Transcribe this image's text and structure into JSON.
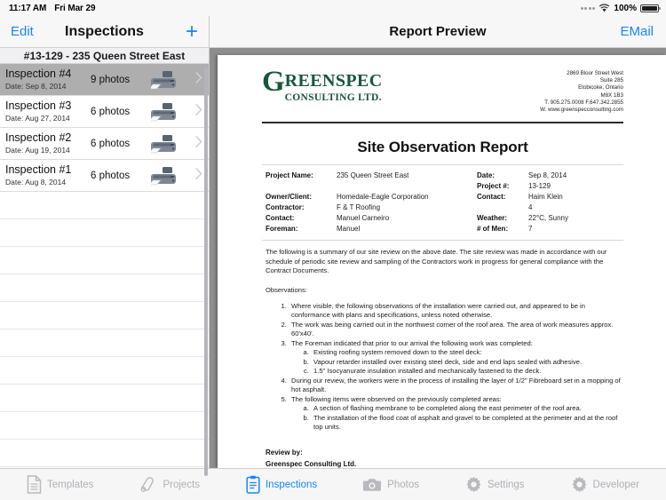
{
  "status_bar": {
    "time": "11:17 AM",
    "date": "Fri Mar 29",
    "battery_pct": "100%",
    "wifi_icon": "wifi-icon",
    "battery_icon": "battery-icon"
  },
  "left_nav": {
    "edit_label": "Edit",
    "title": "Inspections",
    "add_label": "+",
    "add_icon": "plus-icon"
  },
  "list": {
    "section_header": "#13-129 - 235 Queen Street East",
    "rows": [
      {
        "title": "Inspection #4",
        "date": "Date: Sep 8, 2014",
        "photos": "9 photos",
        "selected": true
      },
      {
        "title": "Inspection #3",
        "date": "Date: Aug 27, 2014",
        "photos": "6 photos",
        "selected": false
      },
      {
        "title": "Inspection #2",
        "date": "Date: Aug 19, 2014",
        "photos": "6 photos",
        "selected": false
      },
      {
        "title": "Inspection #1",
        "date": "Date: Aug 8, 2014",
        "photos": "6 photos",
        "selected": false
      }
    ],
    "empty_row_count": 11,
    "row_icon": "printer-icon",
    "disclosure_icon": "chevron-right-icon"
  },
  "doc_nav": {
    "title": "Report Preview",
    "email_label": "EMail"
  },
  "letterhead": {
    "logo_drop_cap": "G",
    "logo_main": "REENSPEC",
    "logo_sub": "CONSULTING LTD.",
    "logo_color": "#16573a",
    "address_lines": [
      "2869 Bloor Street West",
      "Suite 285",
      "Etobicoke, Ontario",
      "M8X 1B3",
      "T. 905.275.0008   F.647.342.2855",
      "W. www.greenspecconsulting.com"
    ]
  },
  "report": {
    "title": "Site Observation Report",
    "info_left": [
      {
        "label": "Project Name:",
        "value": "235 Queen Street East"
      },
      {
        "label": "",
        "value": ""
      },
      {
        "label": "Owner/Client:",
        "value": "Homedale-Eagle Corporation"
      },
      {
        "label": "Contractor:",
        "value": "F & T Roofing"
      },
      {
        "label": "Contact:",
        "value": "Manuel Carneiro"
      },
      {
        "label": "Foreman:",
        "value": "Manuel"
      }
    ],
    "info_right": [
      {
        "label": "Date:",
        "value": "Sep 8, 2014"
      },
      {
        "label": "Project #:",
        "value": "13-129"
      },
      {
        "label": "Contact:",
        "value": "Haim Klein"
      },
      {
        "label": "",
        "value": "4"
      },
      {
        "label": "Weather:",
        "value": "22°C, Sunny"
      },
      {
        "label": "# of Men:",
        "value": "7"
      }
    ],
    "intro_paragraph": "The following is a summary of our site review on the above date. The site review was made in accordance with our schedule of periodic site review and sampling of the Contractors work in progress for general compliance with the Contract Documents.",
    "observations_label": "Observations:",
    "observations": [
      {
        "text": "Where visible, the following observations of the installation were carried out, and appeared to be in conformance with plans and specifications, unless noted otherwise.",
        "sub": []
      },
      {
        "text": "The work was being carried out in the northwest corner of the roof area.  The area of work measures approx. 60'x40'.",
        "sub": []
      },
      {
        "text": "The Foreman indicated that prior to our arrival the following work was completed:",
        "sub": [
          "Existing roofing system removed down to the steel deck:",
          "Vapour retarder installed over existing steel deck, side and end laps sealed with adhesive.",
          "1.5\" Isocyanurate insulation installed and mechanically fastened to the deck."
        ]
      },
      {
        "text": "During our review, the workers were in the process of installing the layer of 1/2\" Fibreboard set in a mopping of hot asphalt.",
        "sub": []
      },
      {
        "text": "The following items were observed on the previously completed areas:",
        "sub": [
          "A section of flashing membrane to be completed along the east perimeter of the roof area.",
          "The installation of the flood coat of asphalt and gravel to be completed at the perimeter and at the roof top units."
        ]
      }
    ],
    "review_by_label": "Review by:",
    "review_by_name": "Greenspec Consulting Ltd."
  },
  "tabbar": {
    "accent_color": "#1a84ff",
    "inactive_color": "#b0b0b5",
    "tabs": [
      {
        "label": "Templates",
        "icon": "document-icon",
        "active": false
      },
      {
        "label": "Projects",
        "icon": "projects-icon",
        "active": false
      },
      {
        "label": "Inspections",
        "icon": "clipboard-icon",
        "active": true
      },
      {
        "label": "Photos",
        "icon": "camera-icon",
        "active": false
      },
      {
        "label": "Settings",
        "icon": "gear-icon",
        "active": false
      },
      {
        "label": "Developer",
        "icon": "gear-icon",
        "active": false
      }
    ]
  }
}
